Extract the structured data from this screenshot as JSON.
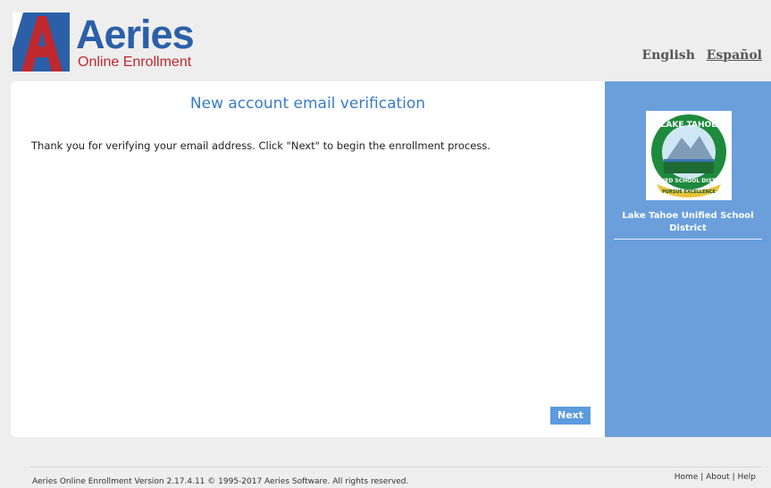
{
  "header": {
    "brand": "Aeries",
    "product": "Online Enrollment",
    "languages": [
      "English",
      "Español"
    ]
  },
  "main": {
    "title": "New account email verification",
    "message": "Thank you for verifying your email address. Click \"Next\" to begin the enrollment process.",
    "next_label": "Next"
  },
  "sidebar": {
    "district_name": "Lake Tahoe Unified School District",
    "logo_text_top": "LAKE TAHOE",
    "logo_text_bottom": "UNIFIED SCHOOL DISTRICT",
    "logo_motto": "PURSUE EXCELLENCE"
  },
  "footer": {
    "copyright": "Aeries Online Enrollment Version 2.17.4.11 © 1995-2017 Aeries Software. All rights reserved.",
    "links": [
      "Home",
      "About",
      "Help"
    ]
  },
  "colors": {
    "brand_blue": "#2b5fa8",
    "brand_red": "#c0282d",
    "accent": "#5b9bde",
    "sidebar": "#6a9fdc"
  }
}
